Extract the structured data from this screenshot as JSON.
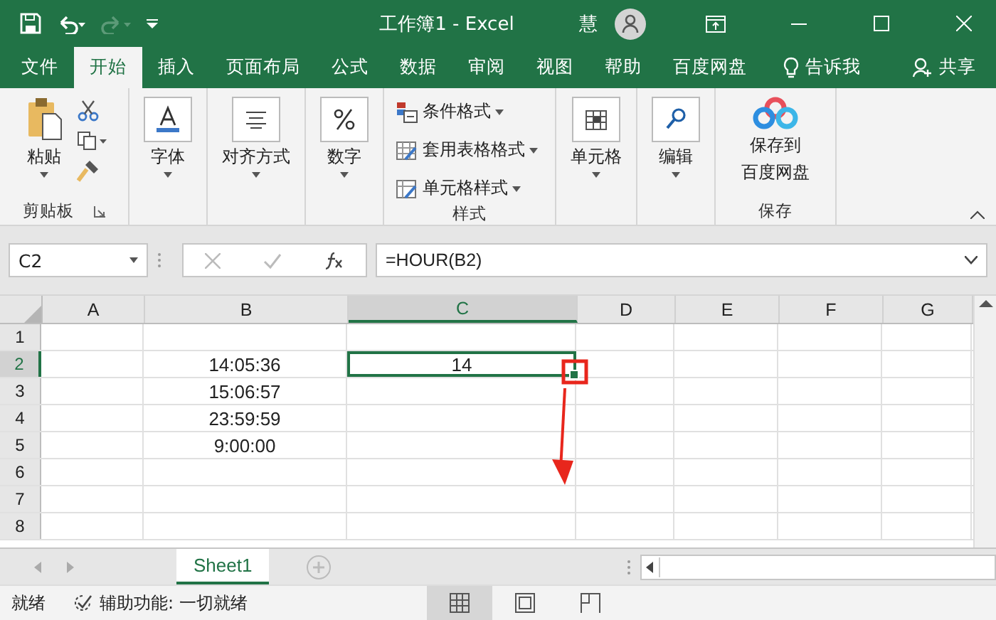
{
  "title_bar": {
    "title": "工作簿1  -  Excel",
    "user_initial": "慧"
  },
  "tabs": [
    {
      "label": "文件",
      "selected": false
    },
    {
      "label": "开始",
      "selected": true
    },
    {
      "label": "插入",
      "selected": false
    },
    {
      "label": "页面布局",
      "selected": false
    },
    {
      "label": "公式",
      "selected": false
    },
    {
      "label": "数据",
      "selected": false
    },
    {
      "label": "审阅",
      "selected": false
    },
    {
      "label": "视图",
      "selected": false
    },
    {
      "label": "帮助",
      "selected": false
    },
    {
      "label": "百度网盘",
      "selected": false
    }
  ],
  "tell_me": "告诉我",
  "share": "共享",
  "ribbon": {
    "clipboard": {
      "paste": "粘贴",
      "label": "剪贴板"
    },
    "buttons": [
      {
        "kind": "font",
        "label": "字体"
      },
      {
        "kind": "align",
        "label": "对齐方式"
      },
      {
        "kind": "number",
        "label": "数字"
      }
    ],
    "styles": {
      "items": [
        {
          "kind": "conditional",
          "label": "条件格式"
        },
        {
          "kind": "table",
          "label": "套用表格格式"
        },
        {
          "kind": "cell",
          "label": "单元格样式"
        }
      ],
      "label": "样式"
    },
    "tools": [
      {
        "kind": "cells",
        "label": "单元格"
      },
      {
        "kind": "edit",
        "label": "编辑"
      }
    ],
    "save": {
      "lines": [
        "保存到",
        "百度网盘"
      ],
      "label": "保存"
    }
  },
  "formula_bar": {
    "name_box": "C2",
    "formula": "=HOUR(B2)"
  },
  "columns": [
    {
      "label": "A",
      "selected": false
    },
    {
      "label": "B",
      "selected": false
    },
    {
      "label": "C",
      "selected": true
    },
    {
      "label": "D",
      "selected": false
    },
    {
      "label": "E",
      "selected": false
    },
    {
      "label": "F",
      "selected": false
    },
    {
      "label": "G",
      "selected": false
    }
  ],
  "rows": [
    {
      "label": "1",
      "selected": false,
      "cells": [
        {
          "active": false
        },
        {
          "active": false
        },
        {
          "active": false
        },
        {
          "active": false
        },
        {
          "active": false
        },
        {
          "active": false
        },
        {
          "active": false
        }
      ]
    },
    {
      "label": "2",
      "selected": true,
      "cells": [
        {
          "active": false
        },
        {
          "value": "14:05:36",
          "active": false
        },
        {
          "value": "14",
          "active": true
        },
        {
          "active": false
        },
        {
          "active": false
        },
        {
          "active": false
        },
        {
          "active": false
        }
      ]
    },
    {
      "label": "3",
      "selected": false,
      "cells": [
        {
          "active": false
        },
        {
          "value": "15:06:57",
          "active": false
        },
        {
          "active": false
        },
        {
          "active": false
        },
        {
          "active": false
        },
        {
          "active": false
        },
        {
          "active": false
        }
      ]
    },
    {
      "label": "4",
      "selected": false,
      "cells": [
        {
          "active": false
        },
        {
          "value": "23:59:59",
          "active": false
        },
        {
          "active": false
        },
        {
          "active": false
        },
        {
          "active": false
        },
        {
          "active": false
        },
        {
          "active": false
        }
      ]
    },
    {
      "label": "5",
      "selected": false,
      "cells": [
        {
          "active": false
        },
        {
          "value": "9:00:00",
          "active": false
        },
        {
          "active": false
        },
        {
          "active": false
        },
        {
          "active": false
        },
        {
          "active": false
        },
        {
          "active": false
        }
      ]
    },
    {
      "label": "6",
      "selected": false,
      "cells": [
        {
          "active": false
        },
        {
          "active": false
        },
        {
          "active": false
        },
        {
          "active": false
        },
        {
          "active": false
        },
        {
          "active": false
        },
        {
          "active": false
        }
      ]
    },
    {
      "label": "7",
      "selected": false,
      "cells": [
        {
          "active": false
        },
        {
          "active": false
        },
        {
          "active": false
        },
        {
          "active": false
        },
        {
          "active": false
        },
        {
          "active": false
        },
        {
          "active": false
        }
      ]
    },
    {
      "label": "8",
      "selected": false,
      "cells": [
        {
          "active": false
        },
        {
          "active": false
        },
        {
          "active": false
        },
        {
          "active": false
        },
        {
          "active": false
        },
        {
          "active": false
        },
        {
          "active": false
        }
      ]
    }
  ],
  "sheets": [
    {
      "label": "Sheet1",
      "selected": true
    }
  ],
  "status_bar": {
    "status": "就绪",
    "accessibility": "辅助功能: 一切就绪",
    "views": [
      {
        "kind": "normal",
        "selected": true
      },
      {
        "kind": "layout",
        "selected": false
      },
      {
        "kind": "pagebreak",
        "selected": false
      }
    ]
  }
}
